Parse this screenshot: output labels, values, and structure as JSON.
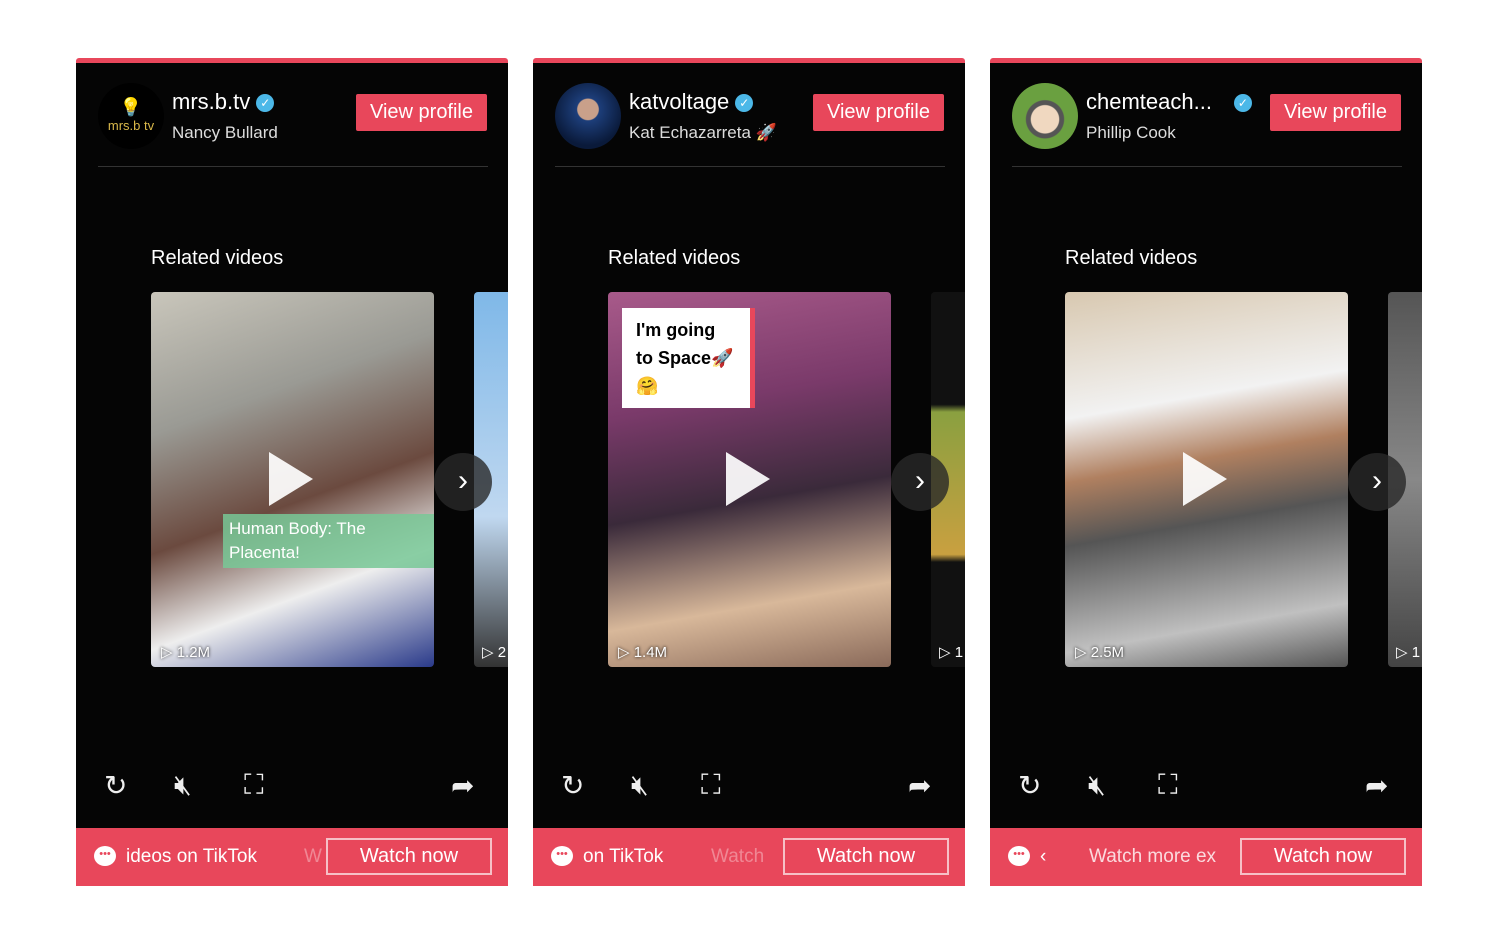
{
  "panels": [
    {
      "username": "mrs.b.tv",
      "display_name": "Nancy Bullard",
      "avatar_text": "mrs.b tv",
      "view_profile": "View profile",
      "related": "Related videos",
      "video_count": "1.2M",
      "video_overlay": "Human Body: The Placenta!",
      "peek_count": "2",
      "bar_text": "ideos on TikTok",
      "bar_fade": "W",
      "watch_now": "Watch now"
    },
    {
      "username": "katvoltage",
      "display_name": "Kat Echazarreta 🚀",
      "view_profile": "View profile",
      "related": "Related videos",
      "video_count": "1.4M",
      "video_overlay": "I'm going to Space🚀🤗",
      "peek_count": "1",
      "bar_text": "on TikTok",
      "bar_fade": "Watch",
      "watch_now": "Watch now"
    },
    {
      "username": "chemteach...",
      "display_name": "Phillip Cook",
      "view_profile": "View profile",
      "related": "Related videos",
      "video_count": "2.5M",
      "peek_count": "1",
      "bar_text": "‹",
      "bar_fade": "Watch more ex",
      "watch_now": "Watch now"
    }
  ],
  "colors": {
    "accent": "#e8475b",
    "verified": "#4cb8e8"
  }
}
